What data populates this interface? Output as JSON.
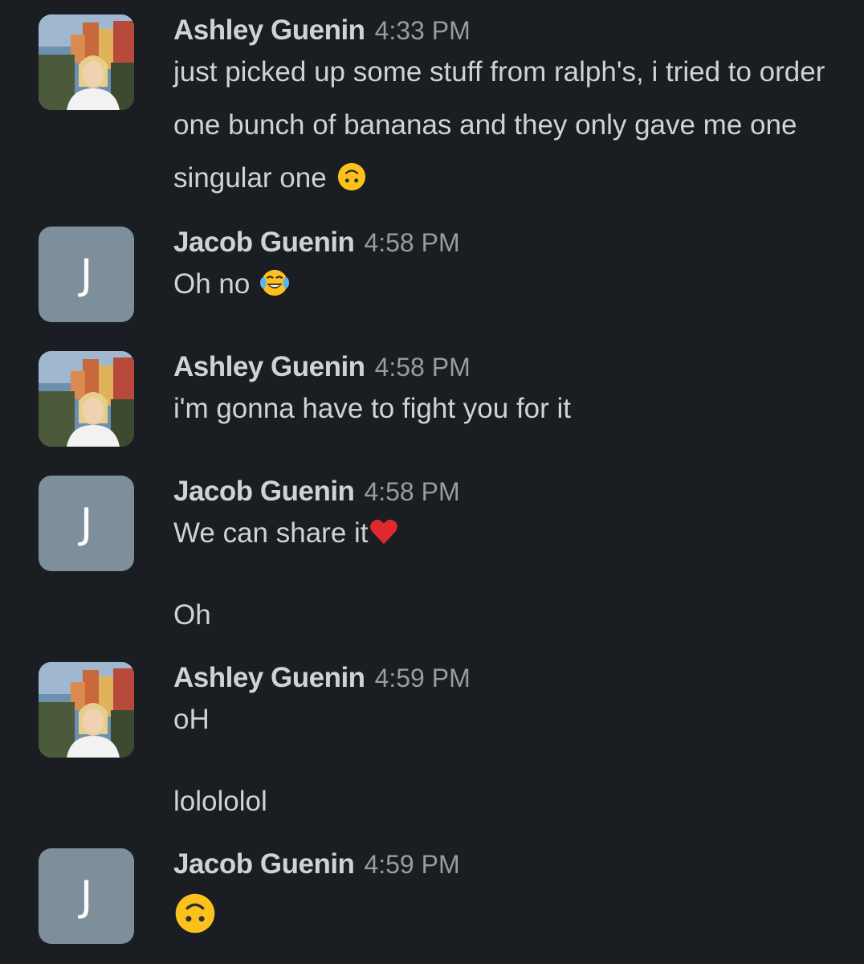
{
  "messages": [
    {
      "sender": "Ashley Guenin",
      "time": "4:33 PM",
      "avatar": "photo",
      "lines": [
        {
          "text": "just picked up some stuff from ralph's, i tried to order one bunch of bananas and they only gave me one singular one",
          "emoji": "upside-down-face-icon"
        }
      ]
    },
    {
      "sender": "Jacob Guenin",
      "time": "4:58 PM",
      "avatar": "J",
      "lines": [
        {
          "text": "Oh no",
          "emoji": "tears-of-joy-icon"
        }
      ]
    },
    {
      "sender": "Ashley Guenin",
      "time": "4:58 PM",
      "avatar": "photo",
      "lines": [
        {
          "text": "i'm gonna have to fight you for it"
        }
      ]
    },
    {
      "sender": "Jacob Guenin",
      "time": "4:58 PM",
      "avatar": "J",
      "lines": [
        {
          "text": "We can share it",
          "emoji": "red-heart-icon"
        },
        {
          "text": "Oh"
        }
      ]
    },
    {
      "sender": "Ashley Guenin",
      "time": "4:59 PM",
      "avatar": "photo",
      "lines": [
        {
          "text": "oH"
        },
        {
          "text": "lolololol"
        }
      ]
    },
    {
      "sender": "Jacob Guenin",
      "time": "4:59 PM",
      "avatar": "J",
      "lines": [
        {
          "text": "",
          "emoji": "upside-down-face-icon"
        }
      ]
    }
  ],
  "colors": {
    "background": "#1a1d21",
    "text": "#d1d2d3",
    "timestamp": "#9a9b9d",
    "letter_avatar": "#7d8f9a"
  }
}
